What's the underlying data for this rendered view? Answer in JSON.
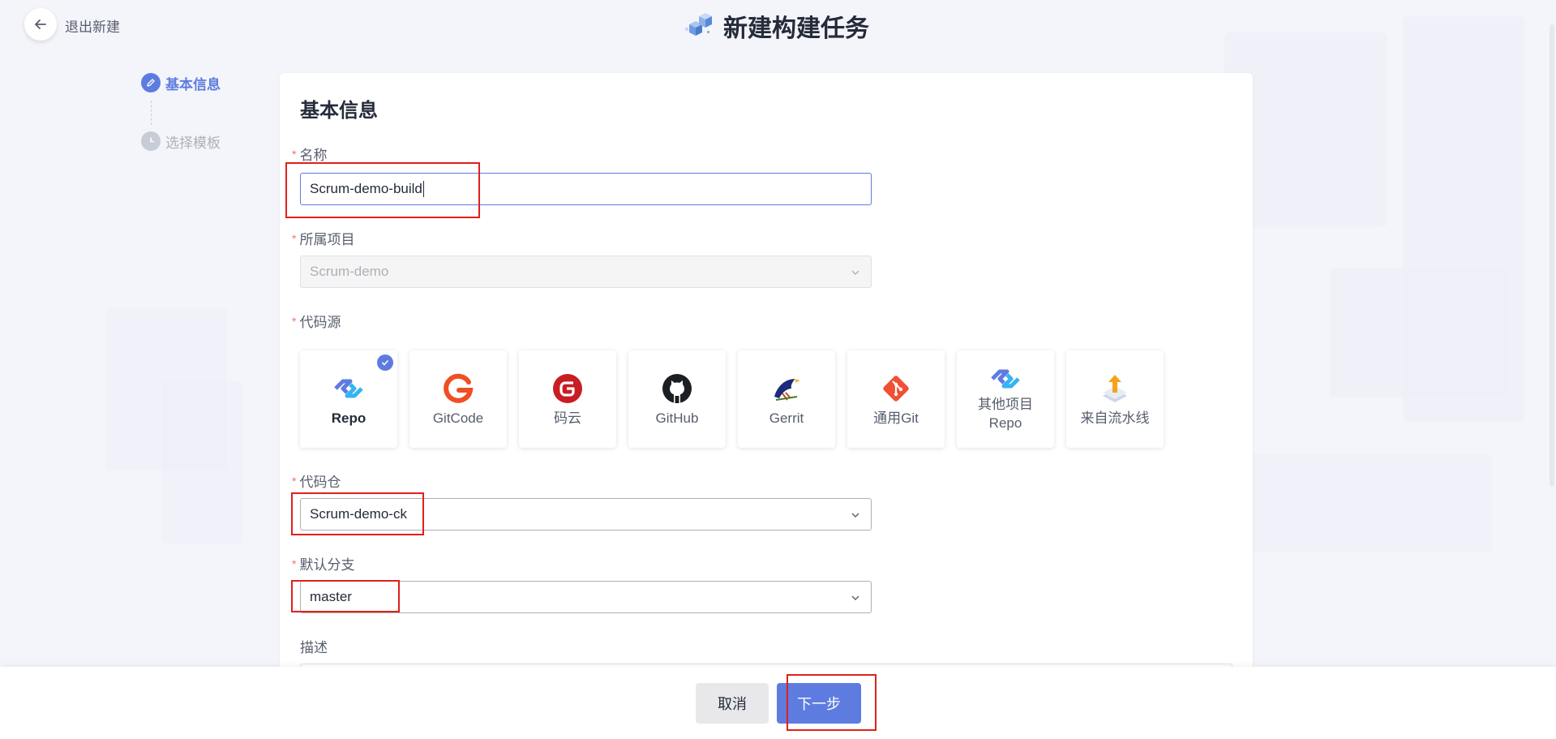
{
  "header": {
    "back_label": "退出新建",
    "title": "新建构建任务"
  },
  "steps": [
    {
      "label": "基本信息",
      "state": "active"
    },
    {
      "label": "选择模板",
      "state": "inactive"
    }
  ],
  "form": {
    "section_title": "基本信息",
    "name": {
      "label": "名称",
      "required": "*",
      "value": "Scrum-demo-build"
    },
    "project": {
      "label": "所属项目",
      "required": "*",
      "value": "Scrum-demo"
    },
    "source": {
      "label": "代码源",
      "required": "*",
      "options": [
        {
          "label": "Repo",
          "icon": "repo-icon",
          "selected": true
        },
        {
          "label": "GitCode",
          "icon": "gitcode-icon",
          "selected": false
        },
        {
          "label": "码云",
          "icon": "gitee-icon",
          "selected": false
        },
        {
          "label": "GitHub",
          "icon": "github-icon",
          "selected": false
        },
        {
          "label": "Gerrit",
          "icon": "gerrit-icon",
          "selected": false
        },
        {
          "label": "通用Git",
          "icon": "git-icon",
          "selected": false
        },
        {
          "label": "其他项目\nRepo",
          "icon": "other-repo-icon",
          "selected": false
        },
        {
          "label": "来自流水线",
          "icon": "pipeline-icon",
          "selected": false
        }
      ]
    },
    "repo": {
      "label": "代码仓",
      "required": "*",
      "value": "Scrum-demo-ck"
    },
    "branch": {
      "label": "默认分支",
      "required": "*",
      "value": "master"
    },
    "description": {
      "label": "描述"
    }
  },
  "footer": {
    "cancel_label": "取消",
    "next_label": "下一步"
  },
  "colors": {
    "accent": "#5e7ce0",
    "required": "#f66f6a",
    "highlight": "#e0201a"
  }
}
